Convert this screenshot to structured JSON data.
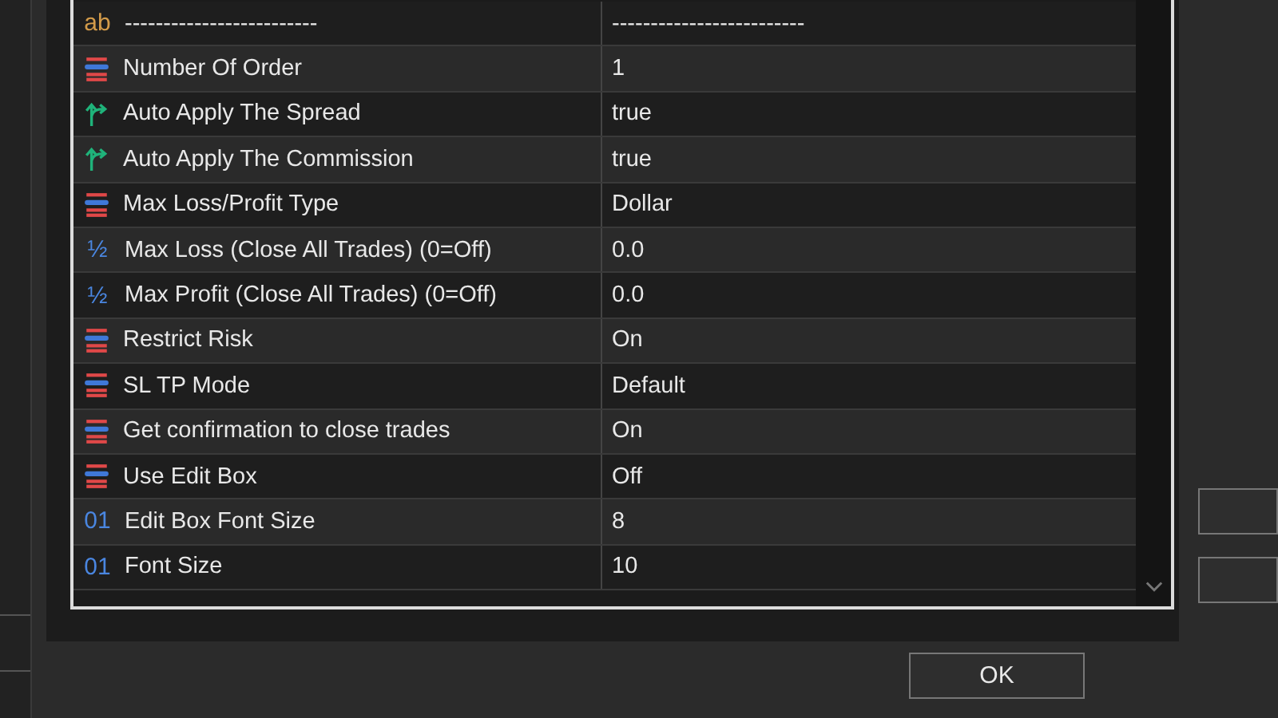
{
  "parameters": {
    "rows": [
      {
        "kind": "text",
        "icon_text": "ab",
        "name": "-------------------------",
        "value": "-------------------------"
      },
      {
        "kind": "enum",
        "name": "Number Of Order",
        "value": "1"
      },
      {
        "kind": "bool",
        "name": "Auto Apply The Spread",
        "value": "true"
      },
      {
        "kind": "bool",
        "name": "Auto Apply The Commission",
        "value": "true"
      },
      {
        "kind": "enum",
        "name": "Max Loss/Profit Type",
        "value": "Dollar"
      },
      {
        "kind": "double",
        "icon_text": "½",
        "name": "Max Loss (Close All Trades) (0=Off)",
        "value": "0.0"
      },
      {
        "kind": "double",
        "icon_text": "½",
        "name": "Max Profit (Close All Trades) (0=Off)",
        "value": "0.0"
      },
      {
        "kind": "enum",
        "name": "Restrict Risk",
        "value": "On"
      },
      {
        "kind": "enum",
        "name": "SL TP Mode",
        "value": "Default"
      },
      {
        "kind": "enum",
        "name": "Get confirmation to close trades",
        "value": "On"
      },
      {
        "kind": "enum",
        "name": "Use Edit Box",
        "value": "Off"
      },
      {
        "kind": "int",
        "icon_text": "01",
        "name": "Edit Box Font Size",
        "value": "8"
      },
      {
        "kind": "int",
        "icon_text": "01",
        "name": "Font Size",
        "value": "10"
      }
    ]
  },
  "ok_button": "OK"
}
